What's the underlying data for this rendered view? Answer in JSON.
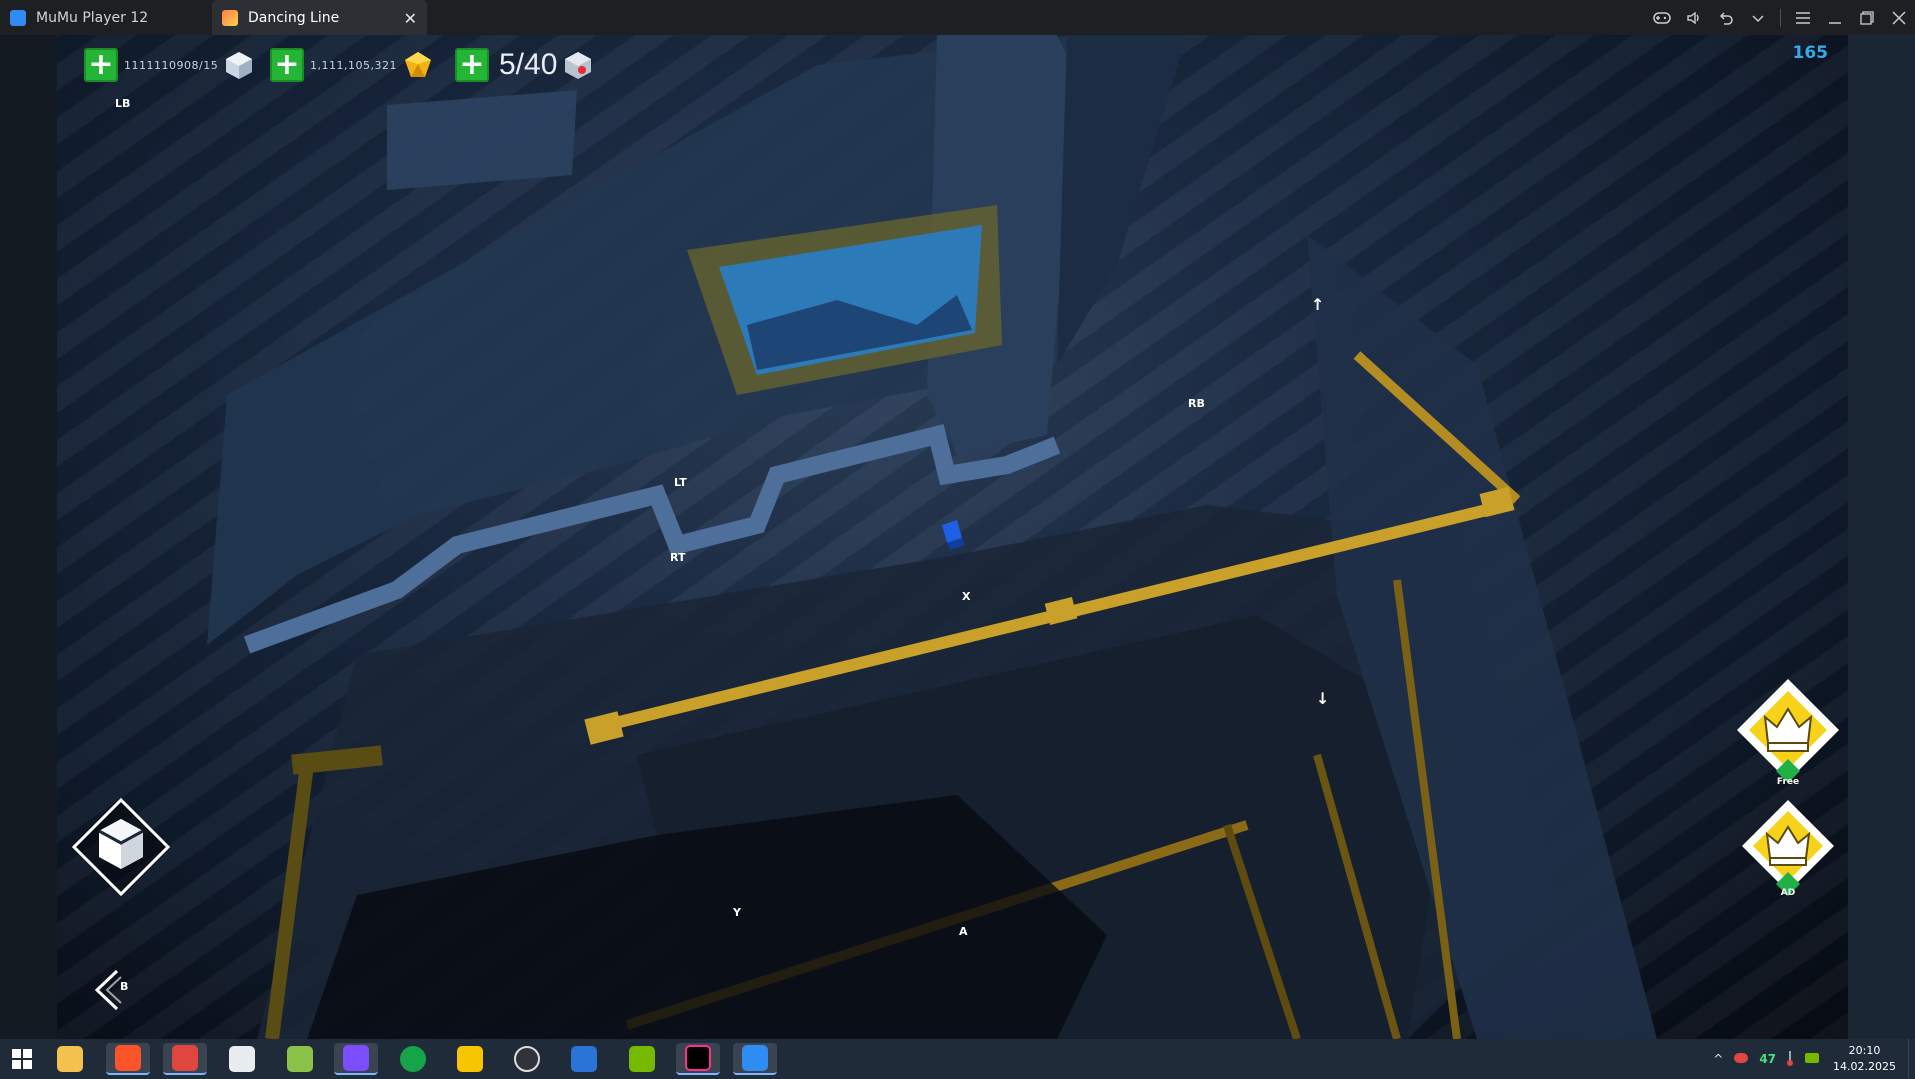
{
  "window": {
    "tabs": [
      {
        "label": "MuMu Player 12",
        "icon": "mumu-icon"
      },
      {
        "label": "Dancing Line",
        "icon": "dancing-line-icon",
        "close": "✕"
      }
    ],
    "controls": [
      "gamepad-icon",
      "volume-icon",
      "undo-icon",
      "dropdown-icon",
      "menu-icon",
      "minimize-icon",
      "restore-icon",
      "close-icon"
    ]
  },
  "hud": {
    "gems_value": "1111110908/15",
    "crowns_value": "1,111,105,321",
    "levels_value": "5/40",
    "fps": "165"
  },
  "controller_labels": {
    "lb": "LB",
    "rb": "RB",
    "lt": "LT",
    "rt": "RT",
    "x": "X",
    "y": "Y",
    "a": "A",
    "b": "B",
    "up": "↑",
    "down": "↓"
  },
  "right_buttons": {
    "free_tag": "Free",
    "ad_tag": "AD"
  },
  "taskbar": {
    "icons": [
      "windows-start-icon",
      "file-explorer-icon",
      "brave-icon",
      "game-controller-icon",
      "firefox-dev-icon",
      "dots-app-icon",
      "obsidian-icon",
      "fps-monitor-icon",
      "rubber-duck-icon",
      "obs-icon",
      "f-app-icon",
      "nvidia-icon",
      "intellij-icon",
      "mumu-player-icon"
    ],
    "tray": {
      "chevron": "^",
      "temp": "47",
      "time": "20:10",
      "date": "14.02.2025"
    }
  },
  "colors": {
    "accent_green": "#24b536",
    "fps_blue": "#3ba8e6",
    "railing_yellow": "#c9a02a",
    "player_cube": "#1d5fe6"
  }
}
